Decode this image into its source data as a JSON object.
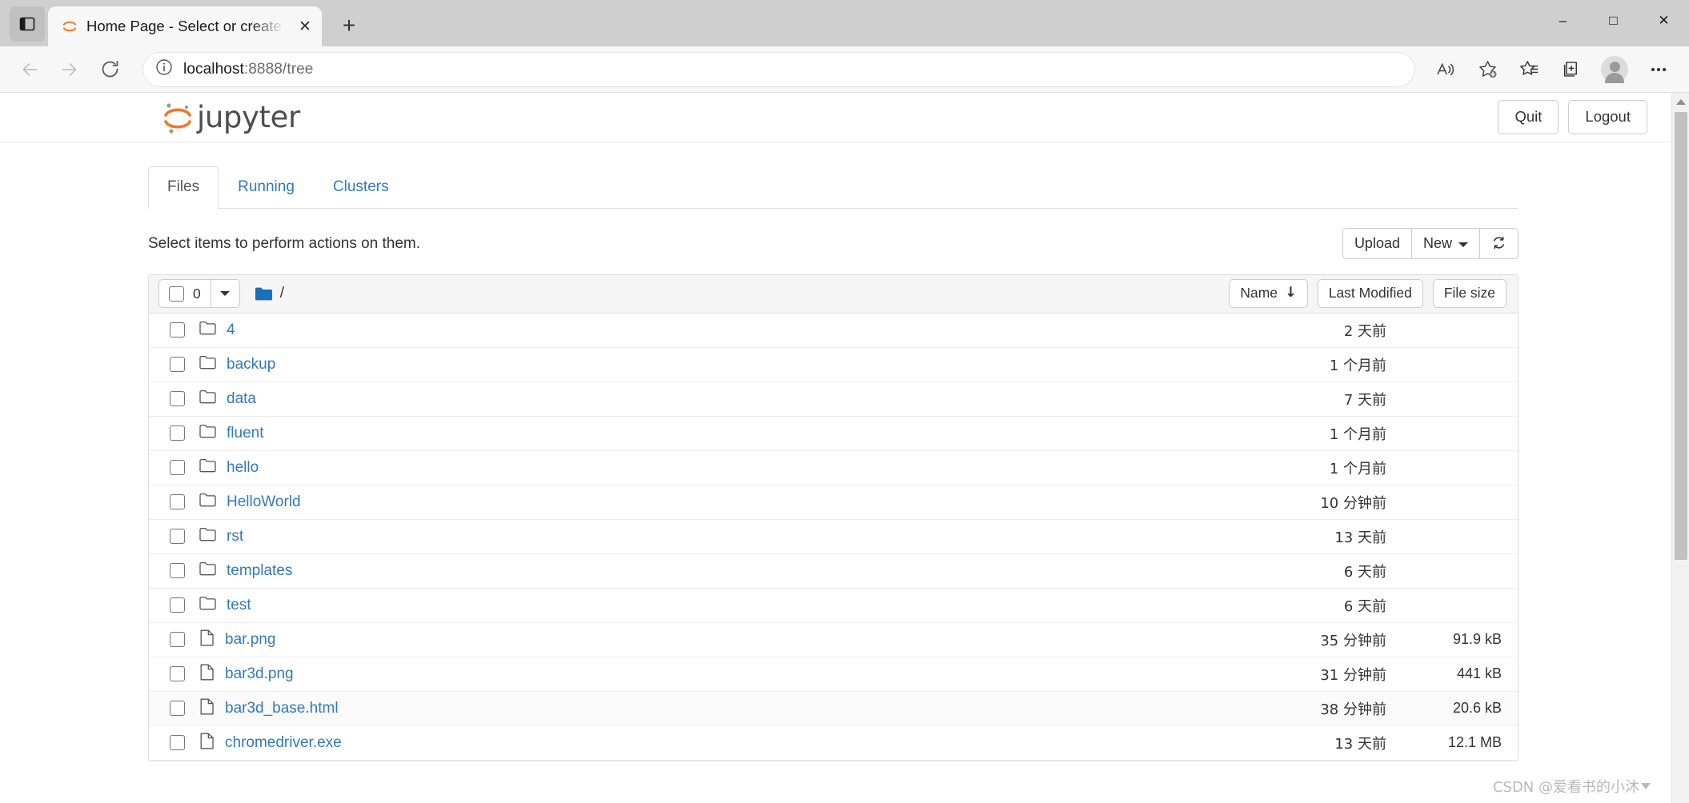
{
  "browser": {
    "tab": {
      "title": "Home Page - Select or create a n",
      "favicon_icon": "jupyter-icon",
      "close_icon": "close-icon"
    },
    "new_tab_label": "+",
    "tab_search_icon": "tab-list-icon",
    "window_controls": {
      "minimize": "–",
      "maximize": "□",
      "close": "✕"
    },
    "nav": {
      "back_icon": "arrow-left-icon",
      "forward_icon": "arrow-right-icon",
      "reload_icon": "reload-icon",
      "site_info_icon": "info-icon",
      "url_host": "localhost",
      "url_rest": ":8888/tree",
      "url_full": "localhost:8888/tree"
    },
    "actions": {
      "read_aloud_icon": "read-aloud-icon",
      "add_favorite_icon": "star-plus-icon",
      "favorites_icon": "favorites-list-icon",
      "collections_icon": "collections-icon",
      "profile_icon": "profile-avatar-icon",
      "settings_icon": "ellipsis-icon"
    }
  },
  "jupyter": {
    "logo_text": "jupyter",
    "quit_label": "Quit",
    "logout_label": "Logout",
    "tabs": [
      {
        "label": "Files",
        "active": true
      },
      {
        "label": "Running",
        "active": false
      },
      {
        "label": "Clusters",
        "active": false
      }
    ],
    "toolbar": {
      "note": "Select items to perform actions on them.",
      "upload_label": "Upload",
      "new_label": "New",
      "refresh_icon": "refresh-icon"
    },
    "list_header": {
      "select_count": "0",
      "select_caret_icon": "chevron-down-icon",
      "folder_icon": "folder-filled-icon",
      "breadcrumb": "/",
      "sort_name": "Name",
      "sort_name_arrow": "↓",
      "sort_modified": "Last Modified",
      "sort_size": "File size"
    },
    "items": [
      {
        "name": "4",
        "type": "folder",
        "modified": "2 天前",
        "size": ""
      },
      {
        "name": "backup",
        "type": "folder",
        "modified": "1 个月前",
        "size": ""
      },
      {
        "name": "data",
        "type": "folder",
        "modified": "7 天前",
        "size": ""
      },
      {
        "name": "fluent",
        "type": "folder",
        "modified": "1 个月前",
        "size": ""
      },
      {
        "name": "hello",
        "type": "folder",
        "modified": "1 个月前",
        "size": ""
      },
      {
        "name": "HelloWorld",
        "type": "folder",
        "modified": "10 分钟前",
        "size": ""
      },
      {
        "name": "rst",
        "type": "folder",
        "modified": "13 天前",
        "size": ""
      },
      {
        "name": "templates",
        "type": "folder",
        "modified": "6 天前",
        "size": ""
      },
      {
        "name": "test",
        "type": "folder",
        "modified": "6 天前",
        "size": ""
      },
      {
        "name": "bar.png",
        "type": "file",
        "modified": "35 分钟前",
        "size": "91.9 kB"
      },
      {
        "name": "bar3d.png",
        "type": "file",
        "modified": "31 分钟前",
        "size": "441 kB"
      },
      {
        "name": "bar3d_base.html",
        "type": "file",
        "modified": "38 分钟前",
        "size": "20.6 kB",
        "highlight": true
      },
      {
        "name": "chromedriver.exe",
        "type": "file",
        "modified": "13 天前",
        "size": "12.1 MB"
      }
    ]
  },
  "watermark": {
    "text": "CSDN @爱看书的小沐"
  },
  "colors": {
    "link": "#337ab7",
    "jupyter_orange": "#f37726",
    "folder_blue": "#196fba",
    "chrome_bg": "#cfcfcf",
    "toolbar_bg": "#f7f7f7"
  }
}
